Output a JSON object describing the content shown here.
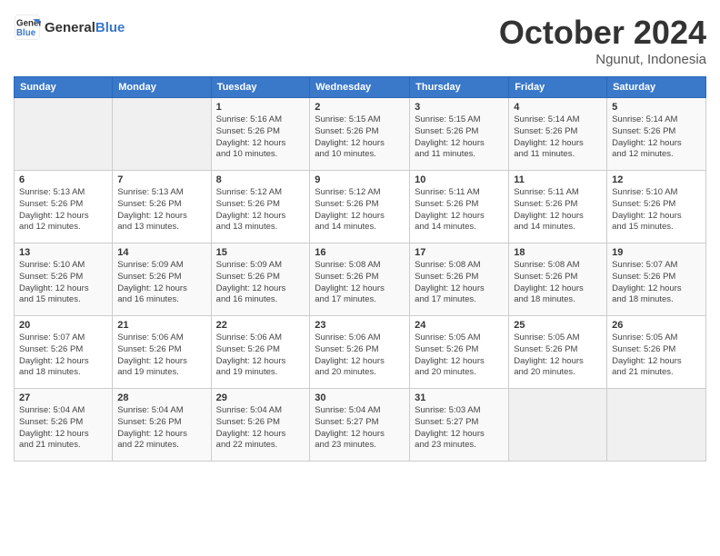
{
  "header": {
    "logo_line1": "General",
    "logo_line2": "Blue",
    "month": "October 2024",
    "location": "Ngunut, Indonesia"
  },
  "weekdays": [
    "Sunday",
    "Monday",
    "Tuesday",
    "Wednesday",
    "Thursday",
    "Friday",
    "Saturday"
  ],
  "weeks": [
    [
      {
        "day": "",
        "empty": true
      },
      {
        "day": "",
        "empty": true
      },
      {
        "day": "1",
        "info": "Sunrise: 5:16 AM\nSunset: 5:26 PM\nDaylight: 12 hours\nand 10 minutes."
      },
      {
        "day": "2",
        "info": "Sunrise: 5:15 AM\nSunset: 5:26 PM\nDaylight: 12 hours\nand 10 minutes."
      },
      {
        "day": "3",
        "info": "Sunrise: 5:15 AM\nSunset: 5:26 PM\nDaylight: 12 hours\nand 11 minutes."
      },
      {
        "day": "4",
        "info": "Sunrise: 5:14 AM\nSunset: 5:26 PM\nDaylight: 12 hours\nand 11 minutes."
      },
      {
        "day": "5",
        "info": "Sunrise: 5:14 AM\nSunset: 5:26 PM\nDaylight: 12 hours\nand 12 minutes."
      }
    ],
    [
      {
        "day": "6",
        "info": "Sunrise: 5:13 AM\nSunset: 5:26 PM\nDaylight: 12 hours\nand 12 minutes."
      },
      {
        "day": "7",
        "info": "Sunrise: 5:13 AM\nSunset: 5:26 PM\nDaylight: 12 hours\nand 13 minutes."
      },
      {
        "day": "8",
        "info": "Sunrise: 5:12 AM\nSunset: 5:26 PM\nDaylight: 12 hours\nand 13 minutes."
      },
      {
        "day": "9",
        "info": "Sunrise: 5:12 AM\nSunset: 5:26 PM\nDaylight: 12 hours\nand 14 minutes."
      },
      {
        "day": "10",
        "info": "Sunrise: 5:11 AM\nSunset: 5:26 PM\nDaylight: 12 hours\nand 14 minutes."
      },
      {
        "day": "11",
        "info": "Sunrise: 5:11 AM\nSunset: 5:26 PM\nDaylight: 12 hours\nand 14 minutes."
      },
      {
        "day": "12",
        "info": "Sunrise: 5:10 AM\nSunset: 5:26 PM\nDaylight: 12 hours\nand 15 minutes."
      }
    ],
    [
      {
        "day": "13",
        "info": "Sunrise: 5:10 AM\nSunset: 5:26 PM\nDaylight: 12 hours\nand 15 minutes."
      },
      {
        "day": "14",
        "info": "Sunrise: 5:09 AM\nSunset: 5:26 PM\nDaylight: 12 hours\nand 16 minutes."
      },
      {
        "day": "15",
        "info": "Sunrise: 5:09 AM\nSunset: 5:26 PM\nDaylight: 12 hours\nand 16 minutes."
      },
      {
        "day": "16",
        "info": "Sunrise: 5:08 AM\nSunset: 5:26 PM\nDaylight: 12 hours\nand 17 minutes."
      },
      {
        "day": "17",
        "info": "Sunrise: 5:08 AM\nSunset: 5:26 PM\nDaylight: 12 hours\nand 17 minutes."
      },
      {
        "day": "18",
        "info": "Sunrise: 5:08 AM\nSunset: 5:26 PM\nDaylight: 12 hours\nand 18 minutes."
      },
      {
        "day": "19",
        "info": "Sunrise: 5:07 AM\nSunset: 5:26 PM\nDaylight: 12 hours\nand 18 minutes."
      }
    ],
    [
      {
        "day": "20",
        "info": "Sunrise: 5:07 AM\nSunset: 5:26 PM\nDaylight: 12 hours\nand 18 minutes."
      },
      {
        "day": "21",
        "info": "Sunrise: 5:06 AM\nSunset: 5:26 PM\nDaylight: 12 hours\nand 19 minutes."
      },
      {
        "day": "22",
        "info": "Sunrise: 5:06 AM\nSunset: 5:26 PM\nDaylight: 12 hours\nand 19 minutes."
      },
      {
        "day": "23",
        "info": "Sunrise: 5:06 AM\nSunset: 5:26 PM\nDaylight: 12 hours\nand 20 minutes."
      },
      {
        "day": "24",
        "info": "Sunrise: 5:05 AM\nSunset: 5:26 PM\nDaylight: 12 hours\nand 20 minutes."
      },
      {
        "day": "25",
        "info": "Sunrise: 5:05 AM\nSunset: 5:26 PM\nDaylight: 12 hours\nand 20 minutes."
      },
      {
        "day": "26",
        "info": "Sunrise: 5:05 AM\nSunset: 5:26 PM\nDaylight: 12 hours\nand 21 minutes."
      }
    ],
    [
      {
        "day": "27",
        "info": "Sunrise: 5:04 AM\nSunset: 5:26 PM\nDaylight: 12 hours\nand 21 minutes."
      },
      {
        "day": "28",
        "info": "Sunrise: 5:04 AM\nSunset: 5:26 PM\nDaylight: 12 hours\nand 22 minutes."
      },
      {
        "day": "29",
        "info": "Sunrise: 5:04 AM\nSunset: 5:26 PM\nDaylight: 12 hours\nand 22 minutes."
      },
      {
        "day": "30",
        "info": "Sunrise: 5:04 AM\nSunset: 5:27 PM\nDaylight: 12 hours\nand 23 minutes."
      },
      {
        "day": "31",
        "info": "Sunrise: 5:03 AM\nSunset: 5:27 PM\nDaylight: 12 hours\nand 23 minutes."
      },
      {
        "day": "",
        "empty": true
      },
      {
        "day": "",
        "empty": true
      }
    ]
  ]
}
